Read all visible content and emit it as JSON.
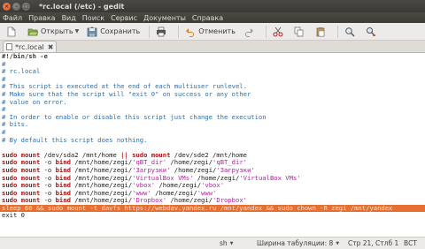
{
  "window": {
    "title": "*rc.local (/etc) - gedit"
  },
  "menu": [
    "Файл",
    "Правка",
    "Вид",
    "Поиск",
    "Сервис",
    "Документы",
    "Справка"
  ],
  "toolbar": {
    "open_label": "Открыть",
    "save_label": "Сохранить",
    "undo_label": "Отменить"
  },
  "tab": {
    "label": "*rc.local"
  },
  "editor": {
    "lines": [
      {
        "segments": [
          {
            "t": "#!/bin/sh -e",
            "c": "shebang"
          }
        ]
      },
      {
        "segments": [
          {
            "t": "#",
            "c": "comment"
          }
        ]
      },
      {
        "segments": [
          {
            "t": "# rc.local",
            "c": "comment"
          }
        ]
      },
      {
        "segments": [
          {
            "t": "#",
            "c": "comment"
          }
        ]
      },
      {
        "segments": [
          {
            "t": "# This script is executed at the end of each multiuser runlevel.",
            "c": "comment"
          }
        ]
      },
      {
        "segments": [
          {
            "t": "# Make sure that the script will \"exit 0\" on success or any other",
            "c": "comment"
          }
        ]
      },
      {
        "segments": [
          {
            "t": "# value on error.",
            "c": "comment"
          }
        ]
      },
      {
        "segments": [
          {
            "t": "#",
            "c": "comment"
          }
        ]
      },
      {
        "segments": [
          {
            "t": "# In order to enable or disable this script just change the execution",
            "c": "comment"
          }
        ]
      },
      {
        "segments": [
          {
            "t": "# bits.",
            "c": "comment"
          }
        ]
      },
      {
        "segments": [
          {
            "t": "#",
            "c": "comment"
          }
        ]
      },
      {
        "segments": [
          {
            "t": "# By default this script does nothing.",
            "c": "comment"
          }
        ]
      },
      {
        "segments": [
          {
            "t": "",
            "c": ""
          }
        ]
      },
      {
        "segments": [
          {
            "t": "sudo mount",
            "c": "kw"
          },
          {
            "t": " /dev/sda2 /mnt/home ",
            "c": ""
          },
          {
            "t": "||",
            "c": "kw"
          },
          {
            "t": " ",
            "c": ""
          },
          {
            "t": "sudo mount",
            "c": "kw"
          },
          {
            "t": " /dev/sde2 /mnt/home",
            "c": ""
          }
        ]
      },
      {
        "segments": [
          {
            "t": "sudo mount",
            "c": "kw"
          },
          {
            "t": " -o ",
            "c": ""
          },
          {
            "t": "bind",
            "c": "kw"
          },
          {
            "t": " /mnt/home/zegi/",
            "c": ""
          },
          {
            "t": "'qBT_dir'",
            "c": "str"
          },
          {
            "t": " /home/zegi/",
            "c": ""
          },
          {
            "t": "'qBT_dir'",
            "c": "str"
          }
        ]
      },
      {
        "segments": [
          {
            "t": "sudo mount",
            "c": "kw"
          },
          {
            "t": " -o ",
            "c": ""
          },
          {
            "t": "bind",
            "c": "kw"
          },
          {
            "t": " /mnt/home/zegi/",
            "c": ""
          },
          {
            "t": "'Загрузки'",
            "c": "str"
          },
          {
            "t": " /home/zegi/",
            "c": ""
          },
          {
            "t": "'Загрузки'",
            "c": "str"
          }
        ]
      },
      {
        "segments": [
          {
            "t": "sudo mount",
            "c": "kw"
          },
          {
            "t": " -o ",
            "c": ""
          },
          {
            "t": "bind",
            "c": "kw"
          },
          {
            "t": " /mnt/home/zegi/",
            "c": ""
          },
          {
            "t": "'VirtualBox VMs'",
            "c": "str"
          },
          {
            "t": " /home/zegi/",
            "c": ""
          },
          {
            "t": "'VirtualBox VMs'",
            "c": "str"
          }
        ]
      },
      {
        "segments": [
          {
            "t": "sudo mount",
            "c": "kw"
          },
          {
            "t": " -o ",
            "c": ""
          },
          {
            "t": "bind",
            "c": "kw"
          },
          {
            "t": " /mnt/home/zegi/",
            "c": ""
          },
          {
            "t": "'vbox'",
            "c": "str"
          },
          {
            "t": " /home/zegi/",
            "c": ""
          },
          {
            "t": "'vbox'",
            "c": "str"
          }
        ]
      },
      {
        "segments": [
          {
            "t": "sudo mount",
            "c": "kw"
          },
          {
            "t": " -o ",
            "c": ""
          },
          {
            "t": "bind",
            "c": "kw"
          },
          {
            "t": " /mnt/home/zegi/",
            "c": ""
          },
          {
            "t": "'www'",
            "c": "str"
          },
          {
            "t": " /home/zegi/",
            "c": ""
          },
          {
            "t": "'www'",
            "c": "str"
          }
        ]
      },
      {
        "segments": [
          {
            "t": "sudo mount",
            "c": "kw"
          },
          {
            "t": " -o ",
            "c": ""
          },
          {
            "t": "bind",
            "c": "kw"
          },
          {
            "t": " /mnt/home/zegi/",
            "c": ""
          },
          {
            "t": "'Dropbox'",
            "c": "str"
          },
          {
            "t": " /home/zegi/",
            "c": ""
          },
          {
            "t": "'Dropbox'",
            "c": "str"
          }
        ]
      },
      {
        "highlight": true,
        "segments": [
          {
            "t": "sleep 60 && sudo mount -t davfs https://webdav.yandex.ru /mnt/yandex && sudo chown -R zegi /mnt/yandex",
            "c": ""
          }
        ]
      },
      {
        "segments": [
          {
            "t": "exit 0",
            "c": ""
          }
        ]
      }
    ]
  },
  "status": {
    "syntax": "sh",
    "tab_width": "Ширина табуляции: 8",
    "position": "Стр 21, Стлб 1",
    "mode": "ВСТ"
  },
  "colors": {
    "comment": "#2c6fb0",
    "keyword": "#a61515",
    "string": "#b520a0",
    "highlight": "#e66f32"
  }
}
